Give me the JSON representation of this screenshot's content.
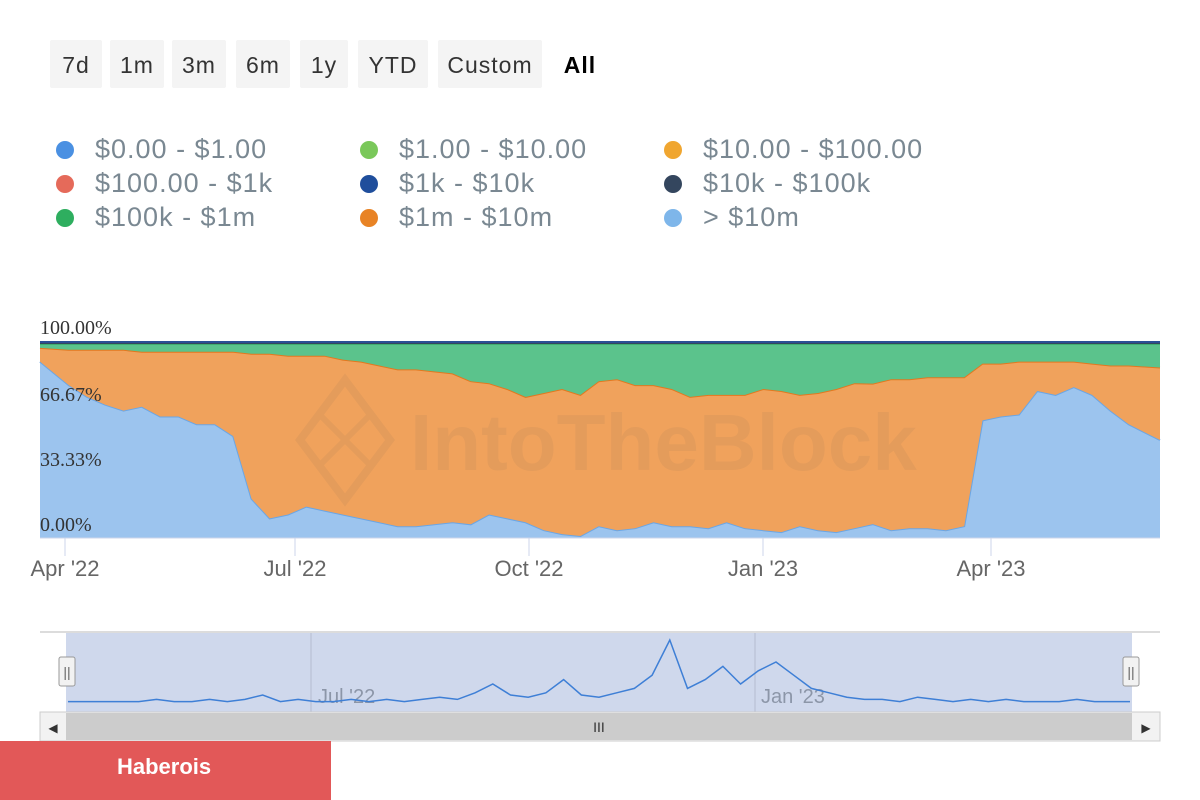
{
  "range_buttons": [
    {
      "label": "7d",
      "active": false
    },
    {
      "label": "1m",
      "active": false
    },
    {
      "label": "3m",
      "active": false
    },
    {
      "label": "6m",
      "active": false
    },
    {
      "label": "1y",
      "active": false
    },
    {
      "label": "YTD",
      "active": false
    },
    {
      "label": "Custom",
      "active": false
    },
    {
      "label": "All",
      "active": true
    }
  ],
  "legend": [
    {
      "label": "$0.00 - $1.00",
      "color": "#4a90e2"
    },
    {
      "label": "$1.00 - $10.00",
      "color": "#7ac85a"
    },
    {
      "label": "$10.00 - $100.00",
      "color": "#f0a630"
    },
    {
      "label": "$100.00 - $1k",
      "color": "#e56a5a"
    },
    {
      "label": "$1k - $10k",
      "color": "#1f4e9c"
    },
    {
      "label": "$10k - $100k",
      "color": "#34465e"
    },
    {
      "label": "$100k - $1m",
      "color": "#2eae5f"
    },
    {
      "label": "$1m - $10m",
      "color": "#e88325"
    },
    {
      "label": "> $10m",
      "color": "#7eb6ea"
    }
  ],
  "watermark": "IntoTheBlock",
  "banner": {
    "label": "Haberois"
  },
  "navigator": {
    "labels": [
      "Jul '22",
      "Jan '23"
    ],
    "handle_glyph": "||",
    "scroll_glyph": "III",
    "left_arrow": "◀",
    "right_arrow": "▶"
  },
  "chart_data": {
    "type": "area",
    "stacking": "percent",
    "y_ticks": [
      "0.00%",
      "33.33%",
      "66.67%",
      "100.00%"
    ],
    "ylim": [
      0,
      100
    ],
    "x_ticks": [
      {
        "date": "2022-04-01",
        "label": "Apr '22"
      },
      {
        "date": "2022-07-01",
        "label": "Jul '22"
      },
      {
        "date": "2022-10-01",
        "label": "Oct '22"
      },
      {
        "date": "2023-01-01",
        "label": "Jan '23"
      },
      {
        "date": "2023-04-01",
        "label": "Apr '23"
      }
    ],
    "x": [
      "2022-03-28",
      "2022-04-04",
      "2022-04-11",
      "2022-04-18",
      "2022-04-25",
      "2022-05-02",
      "2022-05-09",
      "2022-05-16",
      "2022-05-23",
      "2022-05-30",
      "2022-06-06",
      "2022-06-13",
      "2022-06-20",
      "2022-06-27",
      "2022-07-04",
      "2022-07-11",
      "2022-07-18",
      "2022-07-25",
      "2022-08-01",
      "2022-08-08",
      "2022-08-15",
      "2022-08-22",
      "2022-08-29",
      "2022-09-05",
      "2022-09-12",
      "2022-09-19",
      "2022-09-26",
      "2022-10-03",
      "2022-10-10",
      "2022-10-17",
      "2022-10-24",
      "2022-10-31",
      "2022-11-07",
      "2022-11-14",
      "2022-11-21",
      "2022-11-28",
      "2022-12-05",
      "2022-12-12",
      "2022-12-19",
      "2022-12-26",
      "2023-01-02",
      "2023-01-09",
      "2023-01-16",
      "2023-01-23",
      "2023-01-30",
      "2023-02-06",
      "2023-02-13",
      "2023-02-20",
      "2023-02-27",
      "2023-03-06",
      "2023-03-13",
      "2023-03-20",
      "2023-03-27",
      "2023-04-03",
      "2023-04-10",
      "2023-04-17",
      "2023-04-24",
      "2023-05-01",
      "2023-05-08",
      "2023-05-15",
      "2023-05-22"
    ],
    "series": [
      {
        "name": "> $10m",
        "color": "#9cc4ee",
        "values": [
          90,
          78,
          72,
          68,
          65,
          67,
          62,
          62,
          58,
          58,
          52,
          20,
          10,
          12,
          16,
          14,
          12,
          10,
          8,
          6,
          6,
          7,
          8,
          7,
          12,
          10,
          8,
          4,
          2,
          1,
          6,
          4,
          5,
          8,
          6,
          6,
          5,
          8,
          5,
          4,
          3,
          6,
          4,
          3,
          5,
          7,
          4,
          5,
          5,
          4,
          6,
          60,
          62,
          63,
          75,
          73,
          77,
          73,
          65,
          58,
          50
        ]
      },
      {
        "name": "$1m - $10m",
        "color": "#f0a25c",
        "values": [
          7,
          18,
          24,
          28,
          31,
          28,
          33,
          33,
          37,
          37,
          43,
          74,
          84,
          81,
          77,
          79,
          79,
          80,
          80,
          80,
          80,
          78,
          76,
          73,
          67,
          66,
          64,
          70,
          74,
          72,
          74,
          77,
          73,
          70,
          70,
          66,
          68,
          65,
          68,
          72,
          72,
          67,
          70,
          73,
          74,
          71,
          77,
          76,
          77,
          78,
          76,
          29,
          27,
          27,
          15,
          17,
          13,
          16,
          23,
          30,
          37
        ]
      },
      {
        "name": "$100k - $1m",
        "color": "#5bc38c",
        "values": [
          2,
          3,
          3,
          3,
          3,
          4,
          4,
          4,
          4,
          4,
          4,
          5,
          5,
          6,
          6,
          6,
          8,
          9,
          11,
          13,
          13,
          14,
          15,
          19,
          20,
          23,
          27,
          25,
          23,
          26,
          19,
          18,
          21,
          21,
          23,
          27,
          26,
          26,
          26,
          23,
          24,
          26,
          25,
          23,
          20,
          20,
          18,
          18,
          17,
          17,
          17,
          10,
          10,
          9,
          9,
          9,
          9,
          10,
          11,
          11,
          12
        ]
      },
      {
        "name": "$10k - $100k",
        "color": "#34465e",
        "values": [
          0.5,
          0.5,
          0.5,
          0.5,
          0.5,
          0.5,
          0.5,
          0.5,
          0.5,
          0.5,
          0.5,
          0.5,
          0.5,
          0.5,
          0.5,
          0.5,
          0.5,
          0.5,
          0.5,
          0.5,
          0.5,
          0.5,
          0.5,
          0.5,
          0.5,
          0.5,
          0.5,
          0.5,
          0.5,
          0.5,
          0.5,
          0.5,
          0.5,
          0.5,
          0.5,
          0.5,
          0.5,
          0.5,
          0.5,
          0.5,
          0.5,
          0.5,
          0.5,
          0.5,
          0.5,
          0.5,
          0.5,
          0.5,
          0.5,
          0.5,
          0.5,
          0.5,
          0.5,
          0.5,
          0.5,
          0.5,
          0.5,
          0.5,
          0.5,
          0.5,
          0.5
        ]
      },
      {
        "name": "$1k - $10k",
        "color": "#2a4f95",
        "values": [
          0.5,
          0.5,
          0.5,
          0.5,
          0.5,
          0.5,
          0.5,
          0.5,
          0.5,
          0.5,
          0.5,
          0.5,
          0.5,
          0.5,
          0.5,
          0.5,
          0.5,
          0.5,
          0.5,
          0.5,
          0.5,
          0.5,
          0.5,
          0.5,
          0.5,
          0.5,
          0.5,
          0.5,
          0.5,
          0.5,
          0.5,
          0.5,
          0.5,
          0.5,
          0.5,
          0.5,
          0.5,
          0.5,
          0.5,
          0.5,
          0.5,
          0.5,
          0.5,
          0.5,
          0.5,
          0.5,
          0.5,
          0.5,
          0.5,
          0.5,
          0.5,
          0.5,
          0.5,
          0.5,
          0.5,
          0.5,
          0.5,
          0.5,
          0.5,
          0.5,
          0.5
        ]
      }
    ],
    "navigator_series": [
      2,
      2,
      2,
      2,
      2,
      3,
      2,
      2,
      3,
      2,
      3,
      5,
      2,
      3,
      2,
      2,
      3,
      2,
      3,
      2,
      3,
      4,
      3,
      6,
      10,
      5,
      4,
      6,
      12,
      5,
      4,
      6,
      8,
      14,
      30,
      8,
      12,
      18,
      10,
      16,
      20,
      14,
      8,
      6,
      4,
      3,
      3,
      2,
      4,
      3,
      2,
      3,
      2,
      3,
      2,
      2,
      2,
      3,
      2,
      2,
      2
    ]
  }
}
